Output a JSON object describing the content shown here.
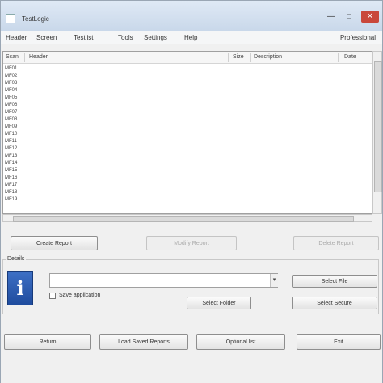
{
  "window": {
    "title": "TestLogic"
  },
  "menu": [
    "Header",
    "Screen",
    "Testlist",
    "Tools",
    "Settings",
    "Help"
  ],
  "menu_right": "Professional",
  "list": {
    "columns": [
      "Scan",
      "Header",
      "Size",
      "Description",
      "Date"
    ],
    "rows": [
      "MF01",
      "MF02",
      "MF03",
      "MF04",
      "MF05",
      "MF06",
      "MF07",
      "MF08",
      "MF09",
      "MF10",
      "MF11",
      "MF12",
      "MF13",
      "MF14",
      "MF15",
      "MF16",
      "MF17",
      "MF18",
      "MF19"
    ]
  },
  "actions": {
    "create": "Create Report",
    "middle": "Modify Report",
    "right": "Delete Report"
  },
  "group": {
    "label": "Details",
    "checkbox_label": "Save application",
    "browse_folder": "Select Folder",
    "select_file": "Select File",
    "select_secure": "Select Secure"
  },
  "bottom": {
    "b1": "Return",
    "b2": "Load Saved Reports",
    "b3": "Optional list",
    "b4": "Exit"
  }
}
